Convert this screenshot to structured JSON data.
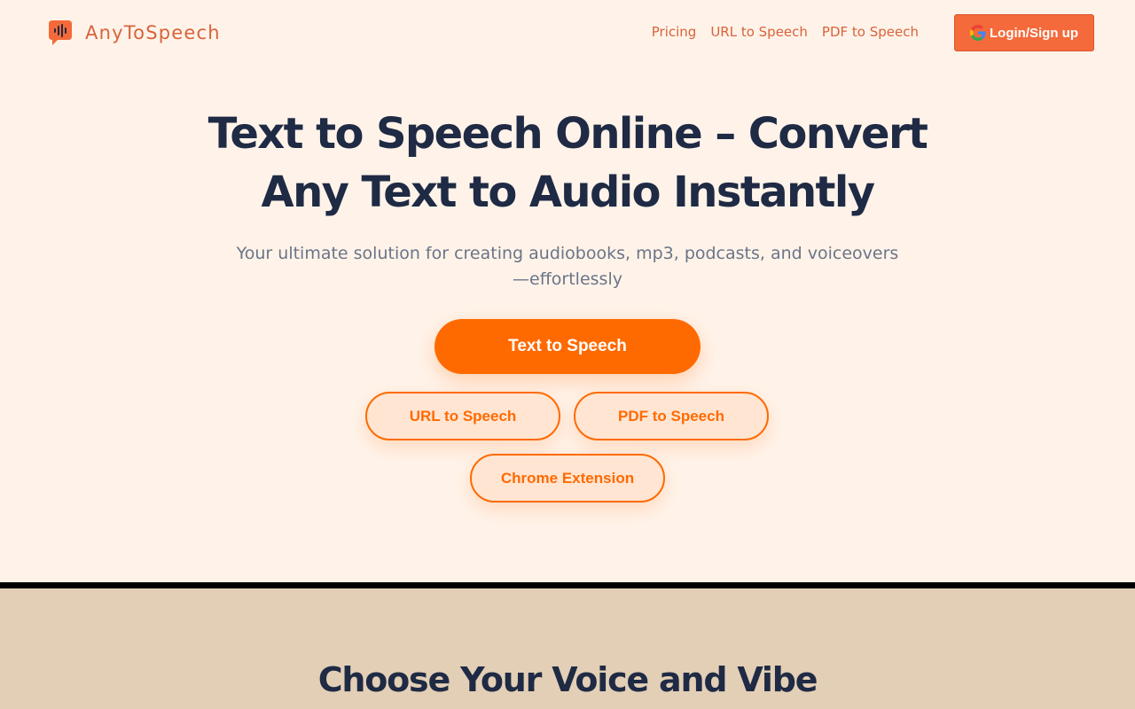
{
  "brand": {
    "name": "AnyToSpeech",
    "icon": "speech-bubble-waveform-icon",
    "color": "#d9623a"
  },
  "nav": {
    "items": [
      {
        "label": "Pricing"
      },
      {
        "label": "URL to Speech"
      },
      {
        "label": "PDF to Speech"
      }
    ]
  },
  "auth": {
    "login_label": "Login/Sign up",
    "icon": "google-icon"
  },
  "hero": {
    "title_line1": "Text to Speech Online – Convert",
    "title_line2": "Any Text to Audio Instantly",
    "subtitle": "Your ultimate solution for creating audiobooks, mp3, podcasts, and voiceovers—effortlessly"
  },
  "actions": {
    "primary_label": "Text to Speech",
    "url_label": "URL to Speech",
    "pdf_label": "PDF to Speech",
    "chrome_label": "Chrome Extension"
  },
  "section2": {
    "title": "Choose Your Voice and Vibe"
  },
  "colors": {
    "page_bg": "#fff3e9",
    "accent": "#ff6a00",
    "login_bg": "#f46a3a",
    "heading": "#1f2a44",
    "section2_bg": "#e2cfb6"
  }
}
